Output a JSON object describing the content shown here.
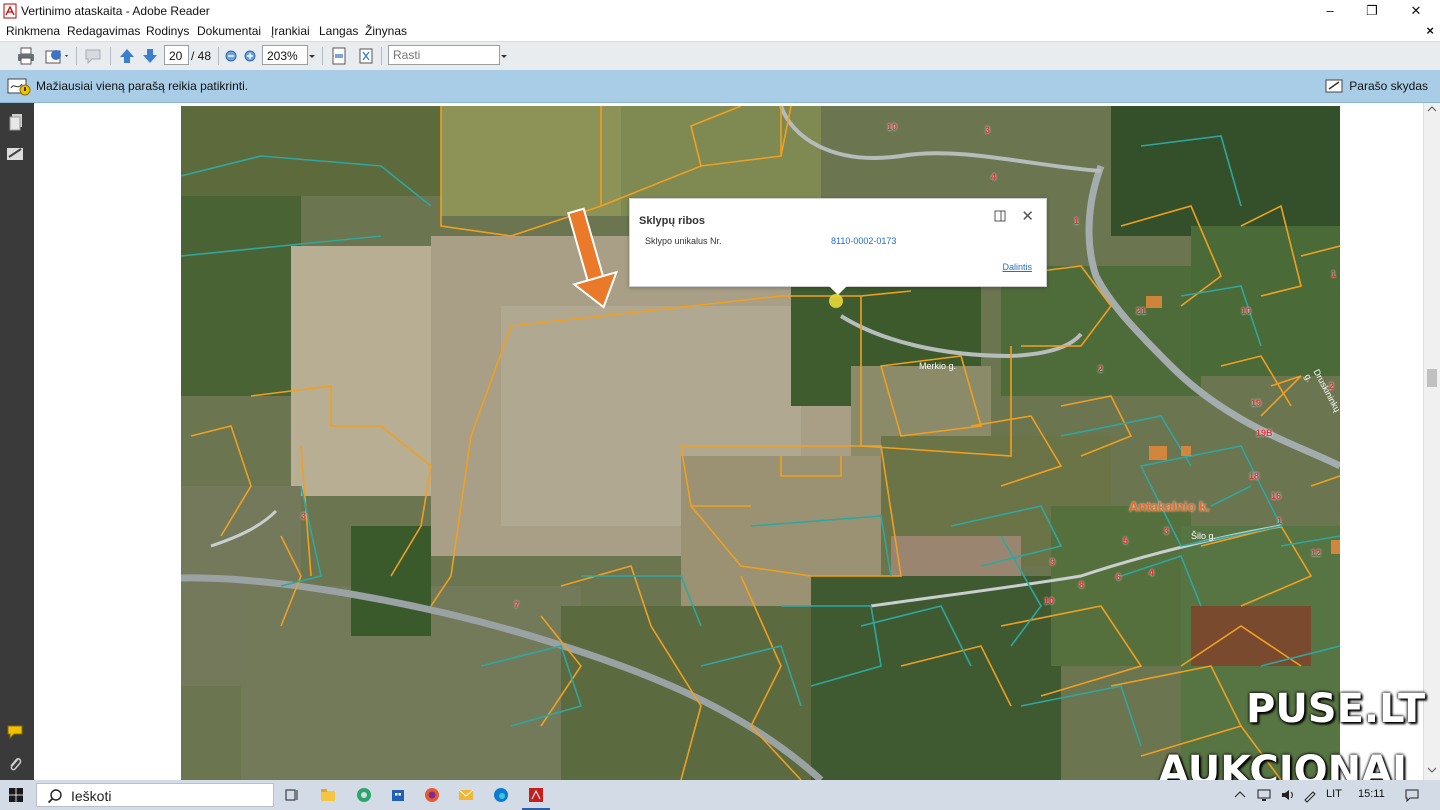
{
  "window": {
    "title": "Vertinimo ataskaita - Adobe Reader",
    "controls": [
      "–",
      "❐",
      "✕"
    ]
  },
  "menu": {
    "items": [
      "Rinkmena",
      "Redagavimas",
      "Rodinys",
      "Dokumentai",
      "Įrankiai",
      "Langas",
      "Žinynas"
    ],
    "close": "×"
  },
  "toolbar": {
    "page_current": "20",
    "page_total": "/ 48",
    "zoom": "203%",
    "find_placeholder": "Rasti"
  },
  "notification": {
    "message": "Mažiausiai vieną parašą reikia patikrinti.",
    "signature_panel": "Parašo skydas"
  },
  "popup": {
    "title": "Sklypų ribos",
    "label": "Sklypo unikalus Nr.",
    "value": "8110-0002-0173",
    "link": "Dalintis"
  },
  "map": {
    "place_label": "Antakalnio k.",
    "road_label_1": "Merkio g.",
    "road_label_2": "Šilo g.",
    "road_label_3": "Druskininkų g.",
    "parcel_numbers": [
      "10",
      "3",
      "4",
      "1",
      "21",
      "2",
      "19",
      "19B",
      "18",
      "16",
      "1",
      "12",
      "3",
      "8",
      "6",
      "4",
      "10",
      "9",
      "10",
      "5",
      "7",
      "3",
      "1",
      "2"
    ]
  },
  "watermark": {
    "line1": "PUSE.LT",
    "line2": "AUKCIONAI"
  },
  "taskbar": {
    "search_placeholder": "Ieškoti",
    "lang": "LIT",
    "time": "15:11"
  },
  "colors": {
    "notify_bar": "#a9cde6",
    "left_nav": "#3a3a3a",
    "parcel_orange": "#f0a020",
    "parcel_teal": "#2fa7a0",
    "arrow_orange": "#ea7a2a",
    "link_blue": "#1f6fd1",
    "popup_point": "#e6d83a"
  }
}
